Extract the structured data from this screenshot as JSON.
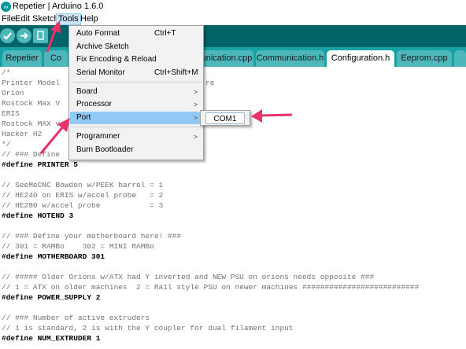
{
  "window": {
    "title": "Repetier | Arduino 1.6.0"
  },
  "menubar": [
    "File",
    "Edit",
    "Sketch",
    "Tools",
    "Help"
  ],
  "toolbar": [
    "verify-icon",
    "upload-icon",
    "new-icon",
    "open-icon",
    "save-icon"
  ],
  "tabs": [
    "Repetier",
    "Co",
    "unication.cpp",
    "Communication.h",
    "Configuration.h",
    "Eeprom.cpp"
  ],
  "tools_menu": {
    "items": [
      {
        "label": "Auto Format",
        "shortcut": "Ctrl+T"
      },
      {
        "label": "Archive Sketch",
        "shortcut": ""
      },
      {
        "label": "Fix Encoding & Reload",
        "shortcut": ""
      },
      {
        "label": "Serial Monitor",
        "shortcut": "Ctrl+Shift+M"
      },
      {
        "label": "Board",
        "shortcut": ""
      },
      {
        "label": "Processor",
        "shortcut": ""
      },
      {
        "label": "Port",
        "shortcut": ""
      },
      {
        "label": "Programmer",
        "shortcut": ""
      },
      {
        "label": "Burn Bootloader",
        "shortcut": ""
      }
    ]
  },
  "port_submenu": {
    "item": "COM1"
  },
  "code_lines": [
    "/*",
    "Printer Model",
    "Orion",
    "Rostock Max V",
    "ERIS",
    "Rostock MAX v",
    "Hacker H2",
    "*/",
    "// ### Define",
    "#define PRINTER 5",
    "",
    "// SeeMeCNC Bowden w/PEEK barrel = 1",
    "// HE240 on ERIS w/accel probe   = 2",
    "// HE280 w/accel probe           = 3",
    "#define HOTEND 3",
    "",
    "// ### Define your motherboard here! ###",
    "// 301 = RAMBo    302 = MINI RAMBo",
    "#define MOTHERBOARD 301",
    "",
    "// ##### Older Orions w/ATX had Y inverted and NEW PSU on orions needs opposite ###",
    "// 1 = ATX on older machines  2 = Rail style PSU on newer machines ##########################",
    "#define POWER_SUPPLY 2",
    "",
    "// ### Number of active extruders",
    "// 1 is standard, 2 is with the Y coupler for dual filament input",
    "#define NUM_EXTRUDER 1"
  ],
  "code_fragments": [
    {
      "text": "re"
    }
  ],
  "colors": {
    "toolbar_bg": "#006468",
    "tabbar_bg": "#17a1a5",
    "menu_highlight": "#91c9f7",
    "annotation_arrow": "#e8326a"
  }
}
